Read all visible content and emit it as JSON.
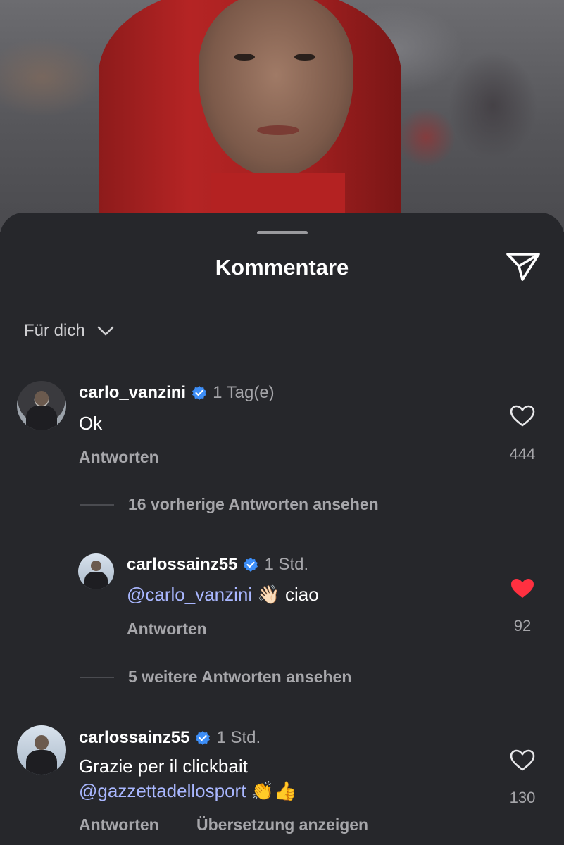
{
  "sheet": {
    "title": "Kommentare",
    "sort_label": "Für dich"
  },
  "icons": {
    "share": "paper-plane-icon",
    "sort_toggle": "chevron-down-icon",
    "verified": "verified-badge-icon",
    "like": "heart-icon"
  },
  "colors": {
    "background": "#26272b",
    "mention": "#a9b7ff",
    "verified": "#3d8ef7",
    "liked": "#ff3040",
    "secondary_text": "#a6a6aa"
  },
  "comments": [
    {
      "username": "carlo_vanzini",
      "time": "1 Tag(e)",
      "text": "Ok",
      "reply_label": "Antworten",
      "likes": "444",
      "liked": false
    },
    {
      "username": "carlossainz55",
      "time": "1 Std.",
      "mention": "@carlo_vanzini",
      "emoji": "👋🏻",
      "text": "ciao",
      "reply_label": "Antworten",
      "likes": "92",
      "liked": true
    },
    {
      "username": "carlossainz55",
      "time": "1 Std.",
      "text": "Grazie per il clickbait",
      "mention": "@gazzettadellosport",
      "emoji": "👏👍",
      "reply_label": "Antworten",
      "translate_label": "Übersetzung anzeigen",
      "likes": "130",
      "liked": false
    }
  ],
  "threads": {
    "previous_replies": "16 vorherige Antworten ansehen",
    "more_replies": "5 weitere Antworten ansehen"
  }
}
